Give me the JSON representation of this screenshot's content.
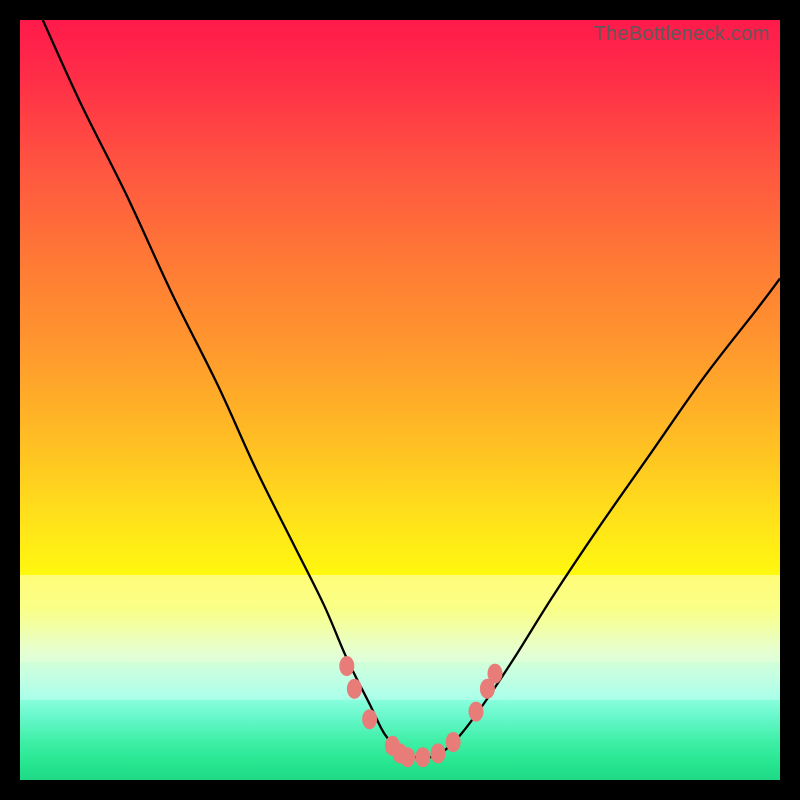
{
  "watermark": "TheBottleneck.com",
  "chart_data": {
    "type": "line",
    "title": "",
    "xlabel": "",
    "ylabel": "",
    "xlim": [
      0,
      100
    ],
    "ylim": [
      0,
      100
    ],
    "series": [
      {
        "name": "bottleneck-curve",
        "x": [
          3,
          8,
          14,
          20,
          26,
          31,
          36,
          40,
          43,
          46,
          48,
          50,
          52,
          54,
          56,
          58,
          61,
          65,
          70,
          76,
          83,
          90,
          97,
          100
        ],
        "y": [
          100,
          89,
          77,
          64,
          52,
          41,
          31,
          23,
          16,
          10,
          6,
          4,
          3,
          3,
          4,
          6,
          10,
          16,
          24,
          33,
          43,
          53,
          62,
          66
        ]
      }
    ],
    "markers": {
      "name": "highlight-points",
      "points": [
        {
          "x": 43,
          "y": 15
        },
        {
          "x": 44,
          "y": 12
        },
        {
          "x": 46,
          "y": 8
        },
        {
          "x": 49,
          "y": 4.5
        },
        {
          "x": 50,
          "y": 3.5
        },
        {
          "x": 51,
          "y": 3
        },
        {
          "x": 53,
          "y": 3
        },
        {
          "x": 55,
          "y": 3.5
        },
        {
          "x": 57,
          "y": 5
        },
        {
          "x": 60,
          "y": 9
        },
        {
          "x": 61.5,
          "y": 12
        },
        {
          "x": 62.5,
          "y": 14
        }
      ]
    },
    "gradient_stops": [
      {
        "pos": 0,
        "color": "#ff1a4b"
      },
      {
        "pos": 50,
        "color": "#ffc023"
      },
      {
        "pos": 75,
        "color": "#fff80f"
      },
      {
        "pos": 100,
        "color": "#1fd986"
      }
    ]
  }
}
